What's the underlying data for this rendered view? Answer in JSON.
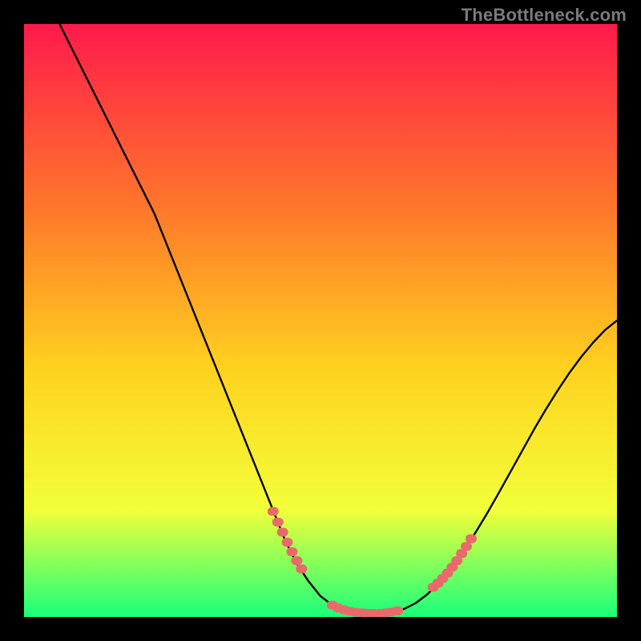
{
  "watermark": "TheBottleneck.com",
  "colors": {
    "gradient_top": "#ff1a4b",
    "gradient_mid1": "#ff7a2a",
    "gradient_mid2": "#ffd21f",
    "gradient_mid3": "#f2ff3a",
    "gradient_bottom": "#19ff7a",
    "curve": "#000000",
    "marker": "#e86a6a",
    "frame": "#000000"
  },
  "chart_data": {
    "type": "line",
    "title": "",
    "xlabel": "",
    "ylabel": "",
    "xlim": [
      0,
      100
    ],
    "ylim": [
      0,
      100
    ],
    "legend": false,
    "grid": false,
    "series": [
      {
        "name": "bottleneck-curve",
        "x": [
          6,
          8,
          10,
          12,
          14,
          16,
          18,
          20,
          22,
          24,
          26,
          28,
          30,
          32,
          34,
          36,
          38,
          40,
          42,
          44,
          46,
          48,
          50,
          52,
          54,
          56,
          58,
          60,
          62,
          64,
          66,
          68,
          70,
          72,
          74,
          76,
          78,
          80,
          82,
          84,
          86,
          88,
          90,
          92,
          94,
          96,
          98,
          100
        ],
        "y": [
          100,
          96,
          92,
          88,
          84,
          80,
          76,
          72,
          68,
          63,
          58,
          53,
          48,
          43,
          38,
          33,
          28,
          23,
          18,
          13,
          9,
          6,
          3.5,
          2,
          1.2,
          0.8,
          0.6,
          0.6,
          0.8,
          1.3,
          2.3,
          3.8,
          5.8,
          8.2,
          11,
          14,
          17.3,
          20.8,
          24.4,
          28,
          31.6,
          35,
          38.2,
          41.2,
          43.9,
          46.3,
          48.4,
          50
        ]
      }
    ],
    "marker_clusters": [
      {
        "name": "left-wall-cluster",
        "points": [
          {
            "x": 42.0,
            "y": 17.8
          },
          {
            "x": 42.8,
            "y": 16.0
          },
          {
            "x": 43.6,
            "y": 14.3
          },
          {
            "x": 44.4,
            "y": 12.6
          },
          {
            "x": 45.2,
            "y": 11.0
          },
          {
            "x": 46.0,
            "y": 9.5
          },
          {
            "x": 46.8,
            "y": 8.1
          }
        ]
      },
      {
        "name": "valley-cluster",
        "points": [
          {
            "x": 52.0,
            "y": 2.0
          },
          {
            "x": 53.0,
            "y": 1.5
          },
          {
            "x": 54.0,
            "y": 1.2
          },
          {
            "x": 55.0,
            "y": 0.95
          },
          {
            "x": 56.0,
            "y": 0.8
          },
          {
            "x": 57.0,
            "y": 0.7
          },
          {
            "x": 58.0,
            "y": 0.6
          },
          {
            "x": 59.0,
            "y": 0.6
          },
          {
            "x": 60.0,
            "y": 0.6
          },
          {
            "x": 61.0,
            "y": 0.7
          },
          {
            "x": 62.0,
            "y": 0.85
          },
          {
            "x": 63.0,
            "y": 1.05
          }
        ]
      },
      {
        "name": "right-wall-cluster",
        "points": [
          {
            "x": 69.0,
            "y": 5.0
          },
          {
            "x": 69.8,
            "y": 5.7
          },
          {
            "x": 70.6,
            "y": 6.5
          },
          {
            "x": 71.4,
            "y": 7.4
          },
          {
            "x": 72.2,
            "y": 8.4
          },
          {
            "x": 73.0,
            "y": 9.5
          },
          {
            "x": 73.8,
            "y": 10.7
          },
          {
            "x": 74.6,
            "y": 11.9
          },
          {
            "x": 75.4,
            "y": 13.2
          }
        ]
      }
    ]
  }
}
